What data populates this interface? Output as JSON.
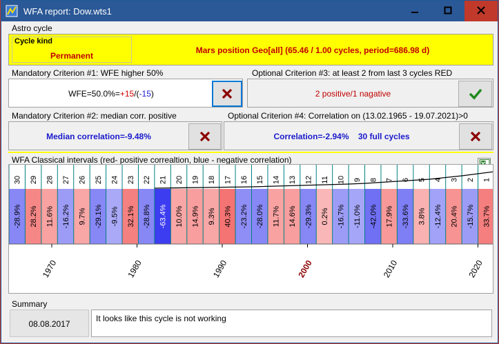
{
  "window": {
    "title": "WFA report: Dow.wts1"
  },
  "titlebar_icons": {
    "minimize": "minimize-icon",
    "maximize": "maximize-icon",
    "close": "close-icon"
  },
  "astro_cycle": {
    "section_label": "Astro cycle",
    "cycle_kind_label": "Cycle kind",
    "cycle_kind_value": "Permanent",
    "description": "Mars position Geo[all]  (65.46 / 1.00 cycles, period=686.98 d)"
  },
  "criterion1": {
    "label": "Mandatory Criterion #1: WFE higher 50%",
    "prefix": "WFE=50.0%=",
    "positive": "+15",
    "separator": "/(",
    "negative": "-15",
    "suffix": ")",
    "result_icon": "cross-icon"
  },
  "criterion3": {
    "label": "Optional Criterion #3: at least 2 from last 3 cycles RED",
    "value": "2 positive/1 nagative",
    "result_icon": "check-icon"
  },
  "criterion2": {
    "label": "Mandatory Criterion #2: median  corr.  positive",
    "value": "Median correlation=-9.48%",
    "result_icon": "cross-icon"
  },
  "criterion4": {
    "label": "Optional Criterion #4: Correlation on (13.02.1965 - 19.07.2021)>0",
    "value": "Correlation=-2.94%    30 full cycles",
    "result_icon": "cross-icon"
  },
  "chart_section": {
    "label": "WFA Classical intervals (red- positive correaltion, blue - negative correlation)",
    "export_icon": "excel-export-icon"
  },
  "chart_data": {
    "type": "heatmap",
    "cycles": [
      {
        "label": "30",
        "value": "-28.9%",
        "sign": -1,
        "intensity": 0.45
      },
      {
        "label": "29",
        "value": "28.2%",
        "sign": 1,
        "intensity": 0.45
      },
      {
        "label": "28",
        "value": "11.6%",
        "sign": 1,
        "intensity": 0.25
      },
      {
        "label": "27",
        "value": "-16.2%",
        "sign": -1,
        "intensity": 0.3
      },
      {
        "label": "26",
        "value": "9.7%",
        "sign": 1,
        "intensity": 0.22
      },
      {
        "label": "25",
        "value": "-29.1%",
        "sign": -1,
        "intensity": 0.45
      },
      {
        "label": "24",
        "value": "-9.5%",
        "sign": -1,
        "intensity": 0.2
      },
      {
        "label": "23",
        "value": "32.1%",
        "sign": 1,
        "intensity": 0.5
      },
      {
        "label": "22",
        "value": "-28.8%",
        "sign": -1,
        "intensity": 0.45
      },
      {
        "label": "21",
        "value": "-63.4%",
        "sign": -1,
        "intensity": 1.0
      },
      {
        "label": "20",
        "value": "10.0%",
        "sign": 1,
        "intensity": 0.22
      },
      {
        "label": "19",
        "value": "14.9%",
        "sign": 1,
        "intensity": 0.28
      },
      {
        "label": "18",
        "value": "9.3%",
        "sign": 1,
        "intensity": 0.22
      },
      {
        "label": "17",
        "value": "40.3%",
        "sign": 1,
        "intensity": 0.6
      },
      {
        "label": "16",
        "value": "-23.2%",
        "sign": -1,
        "intensity": 0.4
      },
      {
        "label": "15",
        "value": "-28.0%",
        "sign": -1,
        "intensity": 0.45
      },
      {
        "label": "14",
        "value": "11.7%",
        "sign": 1,
        "intensity": 0.25
      },
      {
        "label": "13",
        "value": "14.6%",
        "sign": 1,
        "intensity": 0.28
      },
      {
        "label": "12",
        "value": "-29.3%",
        "sign": -1,
        "intensity": 0.45
      },
      {
        "label": "11",
        "value": "0.2%",
        "sign": 1,
        "intensity": 0.1
      },
      {
        "label": "10",
        "value": "-16.7%",
        "sign": -1,
        "intensity": 0.3
      },
      {
        "label": "9",
        "value": "-11.0%",
        "sign": -1,
        "intensity": 0.22
      },
      {
        "label": "8",
        "value": "-42.0%",
        "sign": -1,
        "intensity": 0.62
      },
      {
        "label": "7",
        "value": "17.9%",
        "sign": 1,
        "intensity": 0.32
      },
      {
        "label": "6",
        "value": "-33.6%",
        "sign": -1,
        "intensity": 0.52
      },
      {
        "label": "5",
        "value": "3.8%",
        "sign": 1,
        "intensity": 0.14
      },
      {
        "label": "4",
        "value": "-12.4%",
        "sign": -1,
        "intensity": 0.25
      },
      {
        "label": "3",
        "value": "20.4%",
        "sign": 1,
        "intensity": 0.36
      },
      {
        "label": "2",
        "value": "-15.7%",
        "sign": -1,
        "intensity": 0.3
      },
      {
        "label": "1",
        "value": "33.7%",
        "sign": 1,
        "intensity": 0.52
      }
    ],
    "x_ticks": [
      {
        "label": "1970",
        "highlight": false
      },
      {
        "label": "1980",
        "highlight": false
      },
      {
        "label": "1990",
        "highlight": false
      },
      {
        "label": "2000",
        "highlight": true
      },
      {
        "label": "2010",
        "highlight": false
      },
      {
        "label": "2020",
        "highlight": false
      }
    ],
    "colors": {
      "positive": "#f03c3c",
      "negative": "#3c3cf0",
      "tick_highlight": "#8b0000",
      "grid": "#008080"
    }
  },
  "summary": {
    "section_label": "Summary",
    "date": "08.08.2017",
    "text": "It looks like this cycle is not working"
  }
}
